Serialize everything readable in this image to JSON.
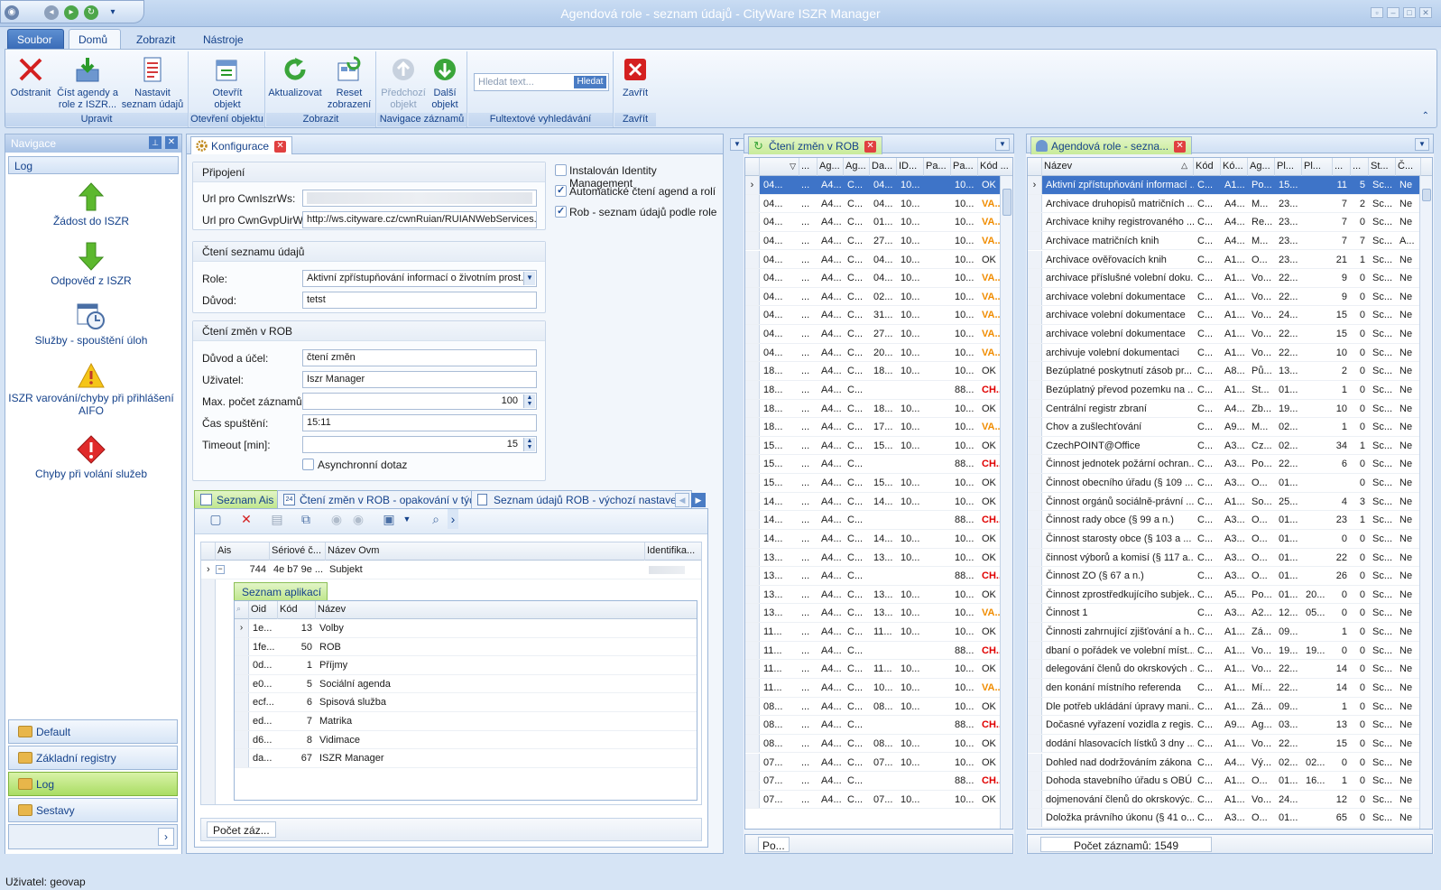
{
  "window": {
    "title": "Agendová role - seznam údajů - CityWare ISZR Manager"
  },
  "ribbon_tabs": [
    "Soubor",
    "Domů",
    "Zobrazit",
    "Nástroje"
  ],
  "ribbon": {
    "groups": [
      "Upravit",
      "Otevření objektu",
      "Zobrazit",
      "Navigace záznamů",
      "Fultextové vyhledávání",
      "Zavřít"
    ],
    "buttons": {
      "odstranit": "Odstranit",
      "cist": "Číst agendy a role z ISZR...",
      "nastavit": "Nastavit seznam údajů",
      "otevrit": "Otevřít objekt",
      "aktualizovat": "Aktualizovat",
      "reset": "Reset zobrazení",
      "predchozi": "Předchozí objekt",
      "dalsi": "Další objekt",
      "zavrit": "Zavřít"
    },
    "search_placeholder": "Hledat text...",
    "search_btn": "Hledat"
  },
  "nav": {
    "title": "Navigace",
    "header": "Log",
    "items": [
      "Žádost do ISZR",
      "Odpověď z ISZR",
      "Služby - spouštění úloh",
      "ISZR varování/chyby při přihlášení AIFO",
      "Chyby při volání služeb"
    ],
    "bars": [
      "Default",
      "Základní registry",
      "Log",
      "Sestavy"
    ]
  },
  "config": {
    "tab": "Konfigurace",
    "pripojeni": {
      "title": "Připojení",
      "url_iszr_label": "Url pro CwnIszrWs:",
      "url_iszr": "",
      "url_gvp_label": "Url pro CwnGvpUirWs:",
      "url_gvp": "http://ws.cityware.cz/cwnRuian/RUIANWebServices."
    },
    "checks": [
      "Instalován Identity Management",
      "Automatické čtení agend a rolí",
      "Rob - seznam údajů podle role"
    ],
    "cteni": {
      "title": "Čtení seznamu údajů",
      "role_label": "Role:",
      "role": "Aktivní zpřístupňování informací o životním prost...",
      "duvod_label": "Důvod:",
      "duvod": "tetst"
    },
    "rob": {
      "title": "Čtení změn v ROB",
      "duvod_label": "Důvod a účel:",
      "duvod": "čtení změn",
      "uzivatel_label": "Uživatel:",
      "uzivatel": "Iszr Manager",
      "max_label": "Max. počet záznamů:",
      "max": "100",
      "cas_label": "Čas spuštění:",
      "cas": "15:11",
      "timeout_label": "Timeout [min]:",
      "timeout": "15",
      "async": "Asynchronní dotaz"
    },
    "bottom_tabs": [
      "Seznam Ais",
      "Čtení změn v ROB - opakování v týdnu",
      "Seznam údajů ROB - výchozí nastavení"
    ],
    "ais_headers": [
      "Ais",
      "Sériové č...",
      "Název Ovm",
      "Identifika..."
    ],
    "ais_row": {
      "ais": "744",
      "serial": "4e b7 9e ...",
      "nazev": "Subjekt"
    },
    "sub_tab": "Seznam aplikací",
    "app_headers": [
      "Oid",
      "Kód",
      "Název"
    ],
    "apps": [
      [
        "1e...",
        "13",
        "Volby"
      ],
      [
        "1fe...",
        "50",
        "ROB"
      ],
      [
        "0d...",
        "1",
        "Příjmy"
      ],
      [
        "e0...",
        "5",
        "Sociální agenda"
      ],
      [
        "ecf...",
        "6",
        "Spisová služba"
      ],
      [
        "ed...",
        "7",
        "Matrika"
      ],
      [
        "d6...",
        "8",
        "Vidimace"
      ],
      [
        "da...",
        "67",
        "ISZR Manager"
      ]
    ],
    "footer": "Počet záz..."
  },
  "rob_panel": {
    "tab": "Čtení změn v ROB",
    "headers": [
      "...",
      "Ag...",
      "Ag...",
      "Da...",
      "ID...",
      "Pa...",
      "Pa...",
      "Kód ..."
    ],
    "footer": "Po...",
    "rows": [
      [
        "04...",
        "A4...",
        "C...",
        "04...",
        "10...",
        "10...",
        "OK"
      ],
      [
        "04...",
        "A4...",
        "C...",
        "04...",
        "10...",
        "10...",
        "VA..."
      ],
      [
        "04...",
        "A4...",
        "C...",
        "01...",
        "10...",
        "10...",
        "VA..."
      ],
      [
        "04...",
        "A4...",
        "C...",
        "27...",
        "10...",
        "10...",
        "VA..."
      ],
      [
        "04...",
        "A4...",
        "C...",
        "04...",
        "10...",
        "10...",
        "OK"
      ],
      [
        "04...",
        "A4...",
        "C...",
        "04...",
        "10...",
        "10...",
        "VA..."
      ],
      [
        "04...",
        "A4...",
        "C...",
        "02...",
        "10...",
        "10...",
        "VA..."
      ],
      [
        "04...",
        "A4...",
        "C...",
        "31...",
        "10...",
        "10...",
        "VA..."
      ],
      [
        "04...",
        "A4...",
        "C...",
        "27...",
        "10...",
        "10...",
        "VA..."
      ],
      [
        "04...",
        "A4...",
        "C...",
        "20...",
        "10...",
        "10...",
        "VA..."
      ],
      [
        "18...",
        "A4...",
        "C...",
        "18...",
        "10...",
        "10...",
        "OK"
      ],
      [
        "18...",
        "A4...",
        "C...",
        "",
        "",
        "88...",
        "CH..."
      ],
      [
        "18...",
        "A4...",
        "C...",
        "18...",
        "10...",
        "10...",
        "OK"
      ],
      [
        "18...",
        "A4...",
        "C...",
        "17...",
        "10...",
        "10...",
        "VA..."
      ],
      [
        "15...",
        "A4...",
        "C...",
        "15...",
        "10...",
        "10...",
        "OK"
      ],
      [
        "15...",
        "A4...",
        "C...",
        "",
        "",
        "88...",
        "CH..."
      ],
      [
        "15...",
        "A4...",
        "C...",
        "15...",
        "10...",
        "10...",
        "OK"
      ],
      [
        "14...",
        "A4...",
        "C...",
        "14...",
        "10...",
        "10...",
        "OK"
      ],
      [
        "14...",
        "A4...",
        "C...",
        "",
        "",
        "88...",
        "CH..."
      ],
      [
        "14...",
        "A4...",
        "C...",
        "14...",
        "10...",
        "10...",
        "OK"
      ],
      [
        "13...",
        "A4...",
        "C...",
        "13...",
        "10...",
        "10...",
        "OK"
      ],
      [
        "13...",
        "A4...",
        "C...",
        "",
        "",
        "88...",
        "CH..."
      ],
      [
        "13...",
        "A4...",
        "C...",
        "13...",
        "10...",
        "10...",
        "OK"
      ],
      [
        "13...",
        "A4...",
        "C...",
        "13...",
        "10...",
        "10...",
        "VA..."
      ],
      [
        "11...",
        "A4...",
        "C...",
        "11...",
        "10...",
        "10...",
        "OK"
      ],
      [
        "11...",
        "A4...",
        "C...",
        "",
        "",
        "88...",
        "CH..."
      ],
      [
        "11...",
        "A4...",
        "C...",
        "11...",
        "10...",
        "10...",
        "OK"
      ],
      [
        "11...",
        "A4...",
        "C...",
        "10...",
        "10...",
        "10...",
        "VA..."
      ],
      [
        "08...",
        "A4...",
        "C...",
        "08...",
        "10...",
        "10...",
        "OK"
      ],
      [
        "08...",
        "A4...",
        "C...",
        "",
        "",
        "88...",
        "CH..."
      ],
      [
        "08...",
        "A4...",
        "C...",
        "08...",
        "10...",
        "10...",
        "OK"
      ],
      [
        "07...",
        "A4...",
        "C...",
        "07...",
        "10...",
        "10...",
        "OK"
      ],
      [
        "07...",
        "A4...",
        "C...",
        "",
        "",
        "88...",
        "CH..."
      ],
      [
        "07...",
        "A4...",
        "C...",
        "07...",
        "10...",
        "10...",
        "OK"
      ]
    ]
  },
  "role_panel": {
    "tab": "Agendová role - sezna...",
    "headers": [
      "Název",
      "Kód",
      "Kó...",
      "Ag...",
      "Pl...",
      "Pl...",
      "...",
      "...",
      "St...",
      "Č..."
    ],
    "footer": "Počet záznamů: 1549",
    "rows": [
      [
        "Aktivní zpřístupňování informací ...",
        "C...",
        "A1...",
        "Po...",
        "15...",
        "",
        "11",
        "5",
        "Sc...",
        "Ne"
      ],
      [
        "Archivace druhopisů matričních ...",
        "C...",
        "A4...",
        "M...",
        "23...",
        "",
        "7",
        "2",
        "Sc...",
        "Ne"
      ],
      [
        "Archivace knihy registrovaného ...",
        "C...",
        "A4...",
        "Re...",
        "23...",
        "",
        "7",
        "0",
        "Sc...",
        "Ne"
      ],
      [
        "Archivace matričních knih",
        "C...",
        "A4...",
        "M...",
        "23...",
        "",
        "7",
        "7",
        "Sc...",
        "A..."
      ],
      [
        "Archivace ověřovacích knih",
        "C...",
        "A1...",
        "O...",
        "23...",
        "",
        "21",
        "1",
        "Sc...",
        "Ne"
      ],
      [
        "archivace příslušné volební doku...",
        "C...",
        "A1...",
        "Vo...",
        "22...",
        "",
        "9",
        "0",
        "Sc...",
        "Ne"
      ],
      [
        "archivace volební dokumentace",
        "C...",
        "A1...",
        "Vo...",
        "22...",
        "",
        "9",
        "0",
        "Sc...",
        "Ne"
      ],
      [
        "archivace volební dokumentace",
        "C...",
        "A1...",
        "Vo...",
        "24...",
        "",
        "15",
        "0",
        "Sc...",
        "Ne"
      ],
      [
        "archivace volební dokumentace",
        "C...",
        "A1...",
        "Vo...",
        "22...",
        "",
        "15",
        "0",
        "Sc...",
        "Ne"
      ],
      [
        "archivuje volební dokumentaci",
        "C...",
        "A1...",
        "Vo...",
        "22...",
        "",
        "10",
        "0",
        "Sc...",
        "Ne"
      ],
      [
        "Bezúplatné poskytnutí zásob pr...",
        "C...",
        "A8...",
        "Pů...",
        "13...",
        "",
        "2",
        "0",
        "Sc...",
        "Ne"
      ],
      [
        "Bezúplatný převod pozemku na ...",
        "C...",
        "A1...",
        "St...",
        "01...",
        "",
        "1",
        "0",
        "Sc...",
        "Ne"
      ],
      [
        "Centrální registr zbraní",
        "C...",
        "A4...",
        "Zb...",
        "19...",
        "",
        "10",
        "0",
        "Sc...",
        "Ne"
      ],
      [
        "Chov a zušlechťování",
        "C...",
        "A9...",
        "M...",
        "02...",
        "",
        "1",
        "0",
        "Sc...",
        "Ne"
      ],
      [
        "CzechPOINT@Office",
        "C...",
        "A3...",
        "Cz...",
        "02...",
        "",
        "34",
        "1",
        "Sc...",
        "Ne"
      ],
      [
        "Činnost jednotek požární ochran...",
        "C...",
        "A3...",
        "Po...",
        "22...",
        "",
        "6",
        "0",
        "Sc...",
        "Ne"
      ],
      [
        "Činnost obecního úřadu (§ 109 ...",
        "C...",
        "A3...",
        "O...",
        "01...",
        "",
        "",
        "0",
        "Sc...",
        "Ne"
      ],
      [
        "Činnost orgánů sociálně-právní ...",
        "C...",
        "A1...",
        "So...",
        "25...",
        "",
        "4",
        "3",
        "Sc...",
        "Ne"
      ],
      [
        "Činnost rady obce (§ 99 a n.)",
        "C...",
        "A3...",
        "O...",
        "01...",
        "",
        "23",
        "1",
        "Sc...",
        "Ne"
      ],
      [
        "Činnost starosty obce (§ 103 a ...",
        "C...",
        "A3...",
        "O...",
        "01...",
        "",
        "0",
        "0",
        "Sc...",
        "Ne"
      ],
      [
        "činnost výborů a komisí (§ 117 a...",
        "C...",
        "A3...",
        "O...",
        "01...",
        "",
        "22",
        "0",
        "Sc...",
        "Ne"
      ],
      [
        "Činnost ZO (§ 67 a n.)",
        "C...",
        "A3...",
        "O...",
        "01...",
        "",
        "26",
        "0",
        "Sc...",
        "Ne"
      ],
      [
        "Činnost zprostředkujícího subjek...",
        "C...",
        "A5...",
        "Po...",
        "01...",
        "20...",
        "0",
        "0",
        "Sc...",
        "Ne"
      ],
      [
        "Činnost 1",
        "C...",
        "A3...",
        "A2...",
        "12...",
        "05...",
        "0",
        "0",
        "Sc...",
        "Ne"
      ],
      [
        "Činnosti zahrnující zjišťování a h...",
        "C...",
        "A1...",
        "Zá...",
        "09...",
        "",
        "1",
        "0",
        "Sc...",
        "Ne"
      ],
      [
        "dbaní o pořádek ve volební míst...",
        "C...",
        "A1...",
        "Vo...",
        "19...",
        "19...",
        "0",
        "0",
        "Sc...",
        "Ne"
      ],
      [
        "delegování členů do okrskových ...",
        "C...",
        "A1...",
        "Vo...",
        "22...",
        "",
        "14",
        "0",
        "Sc...",
        "Ne"
      ],
      [
        "den konání místního referenda",
        "C...",
        "A1...",
        "Mí...",
        "22...",
        "",
        "14",
        "0",
        "Sc...",
        "Ne"
      ],
      [
        "Dle potřeb ukládání úpravy mani...",
        "C...",
        "A1...",
        "Zá...",
        "09...",
        "",
        "1",
        "0",
        "Sc...",
        "Ne"
      ],
      [
        "Dočasné vyřazení vozidla z regis...",
        "C...",
        "A9...",
        "Ag...",
        "03...",
        "",
        "13",
        "0",
        "Sc...",
        "Ne"
      ],
      [
        "dodání hlasovacích lístků 3 dny ...",
        "C...",
        "A1...",
        "Vo...",
        "22...",
        "",
        "15",
        "0",
        "Sc...",
        "Ne"
      ],
      [
        "Dohled nad dodržováním zákona",
        "C...",
        "A4...",
        "Vý...",
        "02...",
        "02...",
        "0",
        "0",
        "Sc...",
        "Ne"
      ],
      [
        "Dohoda stavebního úřadu s OBÚ",
        "C...",
        "A1...",
        "O...",
        "01...",
        "16...",
        "1",
        "0",
        "Sc...",
        "Ne"
      ],
      [
        "dojmenování členů do okrskovýc...",
        "C...",
        "A1...",
        "Vo...",
        "24...",
        "",
        "12",
        "0",
        "Sc...",
        "Ne"
      ],
      [
        "Doložka právního úkonu (§ 41 o...",
        "C...",
        "A3...",
        "O...",
        "01...",
        "",
        "65",
        "0",
        "Sc...",
        "Ne"
      ]
    ]
  },
  "status": {
    "user": "Uživatel: geovap"
  },
  "colors": {
    "accent": "#3e74c8",
    "warn": "#f08c00",
    "error": "#e00000",
    "ok_green": "#5cb82e"
  }
}
